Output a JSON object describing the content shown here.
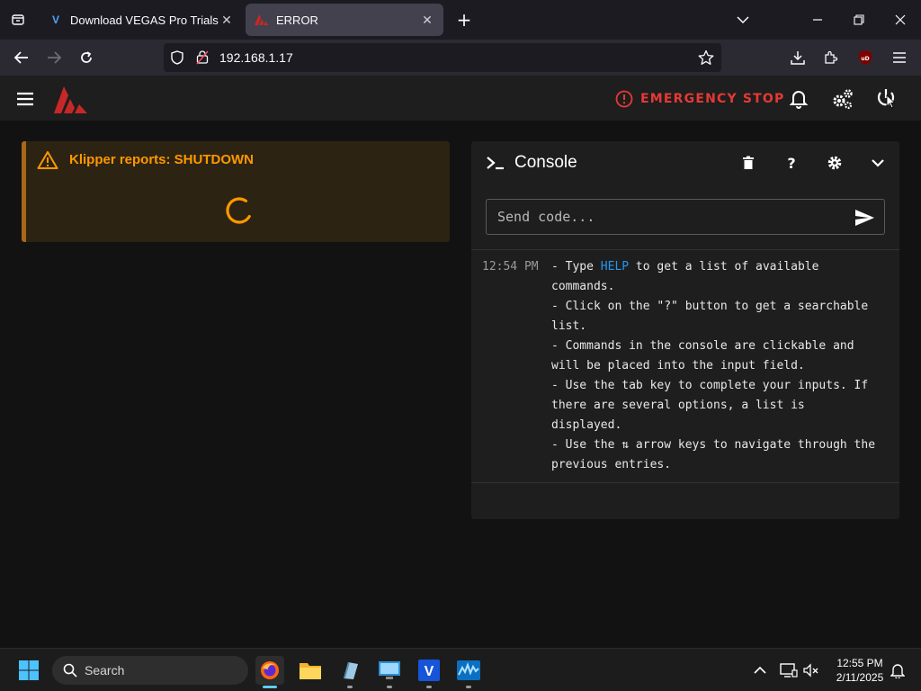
{
  "browser": {
    "tabs": [
      {
        "title": "Download VEGAS Pro Trials for",
        "favicon": "V",
        "active": false
      },
      {
        "title": "ERROR",
        "favicon": "mainsail-logo",
        "active": true
      }
    ],
    "url": "192.168.1.17"
  },
  "app": {
    "emergency_stop_label": "EMERGENCY STOP",
    "colors": {
      "accent_red": "#e53935",
      "warning": "#ff9800",
      "link": "#2196f3"
    }
  },
  "alert": {
    "message": "Klipper reports: SHUTDOWN"
  },
  "console": {
    "title": "Console",
    "input_placeholder": "Send code...",
    "timestamp": "12:54 PM",
    "lines": {
      "l1_pre": "- Type ",
      "l1_cmd": "HELP",
      "l1_post": " to get a list of available",
      "l2": "commands.",
      "l3": "- Click on the \"?\" button to get a searchable",
      "l4": "list.",
      "l5": "- Commands in the console are clickable and",
      "l6": "will be placed into the input field.",
      "l7": "- Use the tab key to complete your inputs. If",
      "l8": "there are several options, a list is",
      "l9": "displayed.",
      "l10": "- Use the ⇅ arrow keys to navigate through the",
      "l11": "previous entries."
    }
  },
  "taskbar": {
    "search_label": "Search",
    "time": "12:55 PM",
    "date": "2/11/2025"
  }
}
